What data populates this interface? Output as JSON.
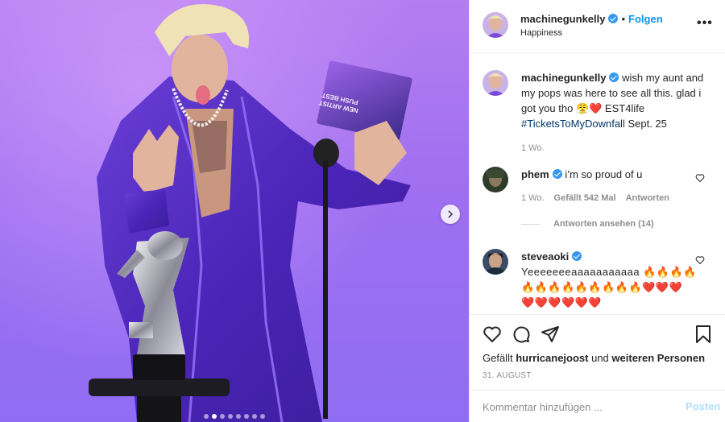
{
  "colors": {
    "accent": "#0095f6",
    "verified": "#3897f0",
    "muted": "#8e8e8e",
    "heart": "#ed4956"
  },
  "media": {
    "slide_count": 8,
    "active_slide": 1,
    "card_text": [
      "PUSH BEST",
      "NEW ARTIST"
    ]
  },
  "header": {
    "username": "machinegunkelly",
    "separator": "•",
    "follow_label": "Folgen",
    "location": "Happiness",
    "more_icon": "more-dots-icon",
    "more_label": "•••"
  },
  "caption": {
    "username": "machinegunkelly",
    "text": "wish my aunt and my pops was here to see all this. glad i got you tho 😤❤️ EST4life",
    "hashtag": "#TicketsToMyDownfall",
    "tail": " Sept. 25",
    "time": "1 Wo."
  },
  "comments": [
    {
      "username": "phem",
      "text": "i’m so proud of u",
      "time": "1 Wo.",
      "likes": "Gefällt 542 Mal",
      "reply": "Antworten",
      "view_replies": "Antworten ansehen (14)"
    },
    {
      "username": "steveaoki",
      "text": "Yeeeeeeeaaaaaaaaaaa 🔥🔥🔥🔥",
      "line2": "🔥🔥🔥🔥🔥🔥🔥🔥🔥❤️❤️❤️",
      "line3": "❤️❤️❤️❤️❤️❤️"
    }
  ],
  "actions": {
    "icons": [
      "heart-icon",
      "comment-icon",
      "share-icon",
      "bookmark-icon"
    ]
  },
  "likes_line": {
    "prefix": "Gefällt ",
    "user": "hurricanejoost",
    "middle": " und ",
    "rest": "weiteren Personen"
  },
  "date": "31. AUGUST",
  "add_comment": {
    "placeholder": "Kommentar hinzufügen ...",
    "post_label": "Posten"
  }
}
